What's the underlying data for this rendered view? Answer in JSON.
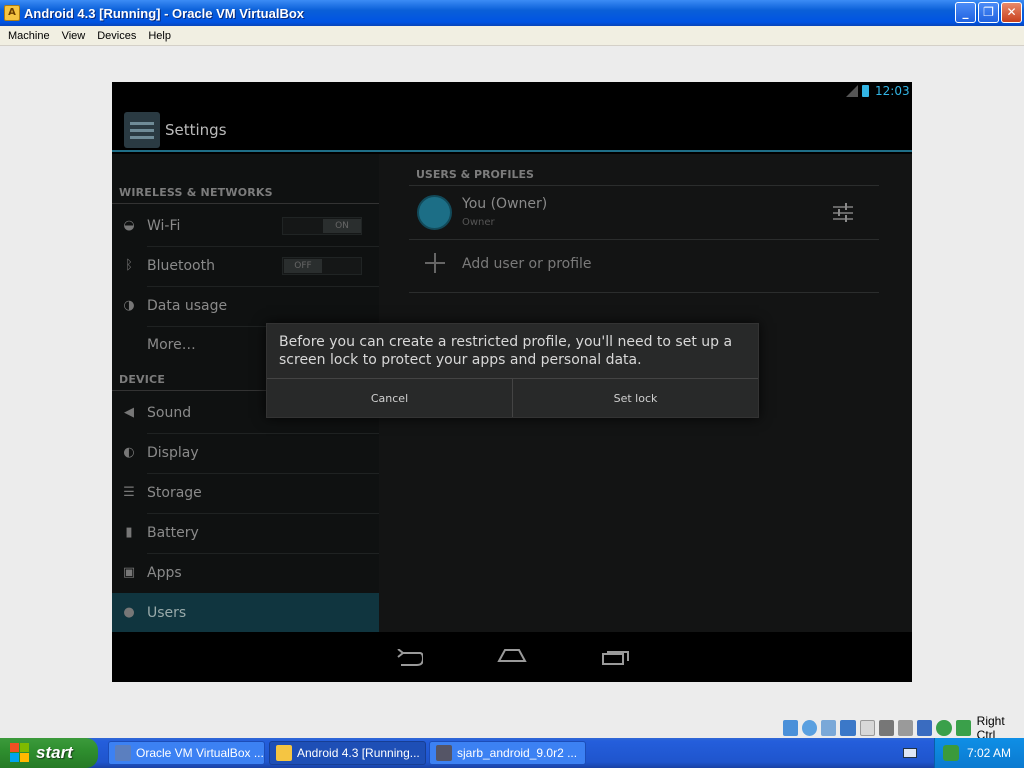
{
  "window": {
    "title": "Android 4.3 [Running] - Oracle VM VirtualBox",
    "minimize": "_",
    "maximize": "❐",
    "close": "✕"
  },
  "menu": [
    "Machine",
    "View",
    "Devices",
    "Help"
  ],
  "android": {
    "status_time": "12:03",
    "action_title": "Settings",
    "sidebar": {
      "wireless_header": "WIRELESS & NETWORKS",
      "wifi": "Wi-Fi",
      "wifi_toggle": "ON",
      "bluetooth": "Bluetooth",
      "bluetooth_toggle": "OFF",
      "data_usage": "Data usage",
      "more": "More…",
      "device_header": "DEVICE",
      "sound": "Sound",
      "display": "Display",
      "storage": "Storage",
      "battery": "Battery",
      "apps": "Apps",
      "users": "Users"
    },
    "users": {
      "header": "USERS & PROFILES",
      "owner_name": "You (Owner)",
      "owner_sub": "Owner",
      "add_label": "Add user or profile"
    },
    "dialog": {
      "message": "Before you can create a restricted profile, you'll need to set up a screen lock to protect your apps and personal data.",
      "cancel": "Cancel",
      "set_lock": "Set lock"
    }
  },
  "vbox_status": {
    "host_key": "Right Ctrl"
  },
  "taskbar": {
    "start": "start",
    "tasks": [
      "Oracle VM VirtualBox ...",
      "Android 4.3 [Running...",
      "sjarb_android_9.0r2 ..."
    ],
    "clock": "7:02 AM"
  },
  "colors": {
    "android_accent": "#33b5e5",
    "xp_blue": "#0054e3",
    "start_green": "#2f8f2f"
  }
}
